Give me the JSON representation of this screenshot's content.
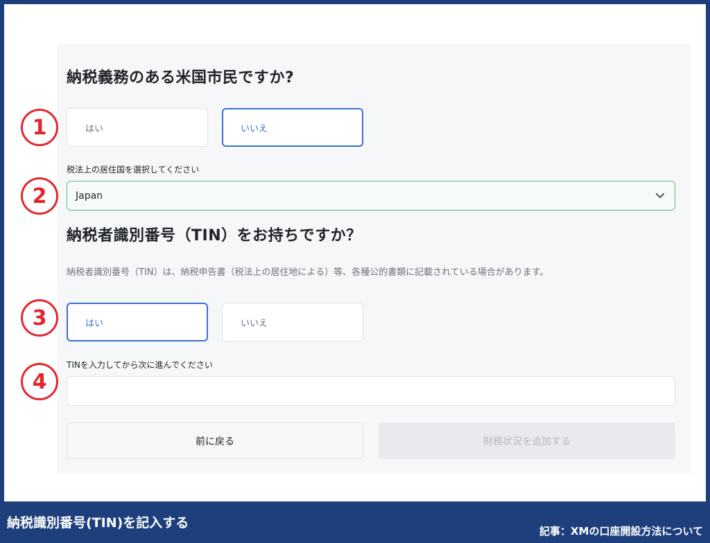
{
  "section1": {
    "title": "納税義務のある米国市民ですか?",
    "options": [
      "はい",
      "いいえ"
    ],
    "selected": "いいえ"
  },
  "country": {
    "label": "税法上の居住国を選択してください",
    "value": "Japan",
    "icon": "chevron-down-icon"
  },
  "section2": {
    "title": "納税者識別番号（TIN）をお持ちですか？",
    "description": "納税者識別番号（TIN）は、納税申告書（税法上の居住地による）等、各種公的書類に記載されている場合があります。",
    "options": [
      "はい",
      "いいえ"
    ],
    "selected": "はい"
  },
  "tin": {
    "label": "TINを入力してから次に進んでください",
    "value": ""
  },
  "buttons": {
    "back": "前に戻る",
    "next": "財務状況を追加する"
  },
  "markers": [
    "1",
    "2",
    "3",
    "4"
  ],
  "caption": {
    "left": "納税識別番号(TIN)を記入する",
    "right": "記事：XMの口座開設方法について"
  },
  "colors": {
    "accent": "#3a6fd0",
    "marker": "#e3262d",
    "banner": "#1d3f7c",
    "select_border": "#5eb882"
  }
}
